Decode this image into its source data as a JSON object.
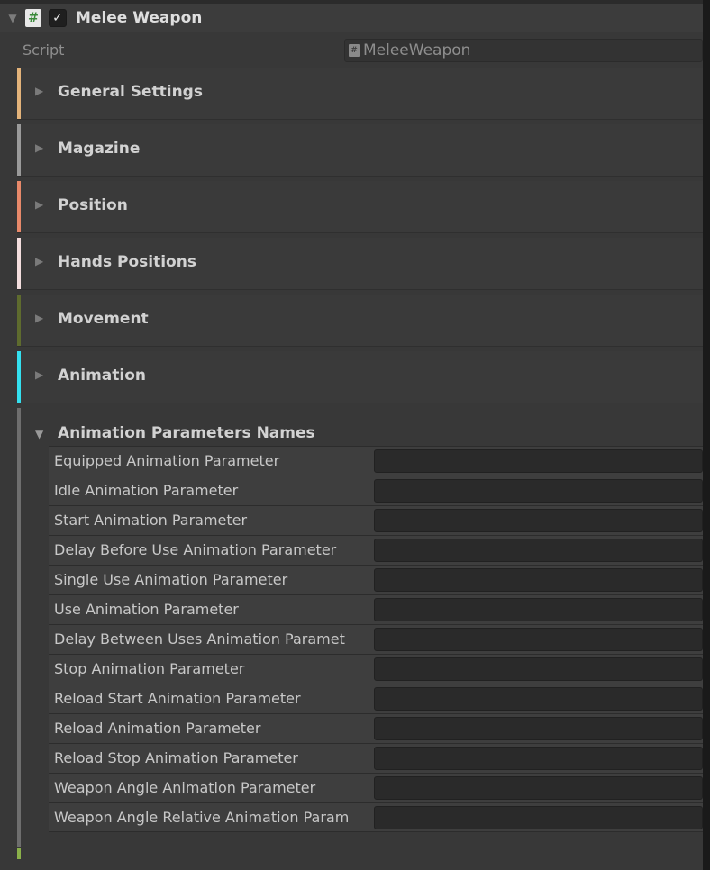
{
  "component": {
    "title": "Melee Weapon",
    "script_icon": "#",
    "enabled_check": "✓",
    "fold_arrow": "▼"
  },
  "script_field": {
    "label": "Script",
    "value": "MeleeWeapon",
    "icon": "#"
  },
  "sections": [
    {
      "label": "General Settings",
      "color": "#e3b37a",
      "arrow": "▶"
    },
    {
      "label": "Magazine",
      "color": "#9a9a9a",
      "arrow": "▶"
    },
    {
      "label": "Position",
      "color": "#e8896a",
      "arrow": "▶"
    },
    {
      "label": "Hands Positions",
      "color": "#f3dede",
      "arrow": "▶"
    },
    {
      "label": "Movement",
      "color": "#5e6b2e",
      "arrow": "▶"
    },
    {
      "label": "Animation",
      "color": "#34e0ef",
      "arrow": "▶"
    }
  ],
  "anim_params": {
    "label": "Animation Parameters Names",
    "arrow": "▼",
    "color": "#6e6e6e",
    "rows": [
      {
        "label": "Equipped Animation Parameter",
        "value": ""
      },
      {
        "label": "Idle Animation Parameter",
        "value": ""
      },
      {
        "label": "Start Animation Parameter",
        "value": ""
      },
      {
        "label": "Delay Before Use Animation Parameter",
        "value": ""
      },
      {
        "label": "Single Use Animation Parameter",
        "value": ""
      },
      {
        "label": "Use Animation Parameter",
        "value": ""
      },
      {
        "label": "Delay Between Uses Animation Paramet",
        "value": ""
      },
      {
        "label": "Stop Animation Parameter",
        "value": ""
      },
      {
        "label": "Reload Start Animation Parameter",
        "value": ""
      },
      {
        "label": "Reload Animation Parameter",
        "value": ""
      },
      {
        "label": "Reload Stop Animation Parameter",
        "value": ""
      },
      {
        "label": "Weapon Angle Animation Parameter",
        "value": ""
      },
      {
        "label": "Weapon Angle Relative Animation Param",
        "value": ""
      }
    ]
  }
}
